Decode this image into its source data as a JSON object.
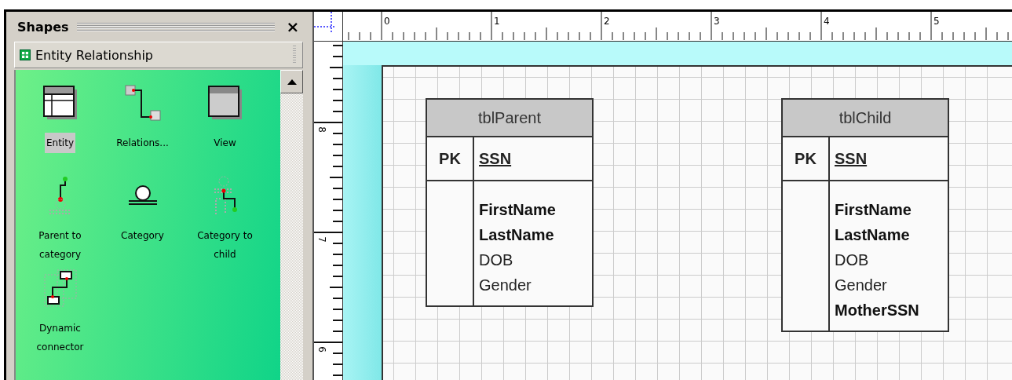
{
  "shapes_panel": {
    "title": "Shapes",
    "close": "×",
    "stencil": {
      "title": "Entity Relationship"
    },
    "items": [
      {
        "label": "Entity",
        "selected": true
      },
      {
        "label": "Relations...",
        "selected": false
      },
      {
        "label": "View",
        "selected": false
      },
      {
        "label": "Parent to category",
        "selected": false
      },
      {
        "label": "Category",
        "selected": false
      },
      {
        "label": "Category to child",
        "selected": false
      },
      {
        "label": "Dynamic connector",
        "selected": false
      }
    ]
  },
  "rulers": {
    "top_labels": [
      "0",
      "1",
      "2",
      "3",
      "4",
      "5"
    ],
    "left_labels": [
      "8",
      "7",
      "6"
    ]
  },
  "tables": [
    {
      "name": "tblParent",
      "key_label": "PK",
      "key_field": "SSN",
      "fields": [
        {
          "name": "FirstName",
          "bold": true
        },
        {
          "name": "LastName",
          "bold": true
        },
        {
          "name": "DOB",
          "bold": false
        },
        {
          "name": "Gender",
          "bold": false
        }
      ]
    },
    {
      "name": "tblChild",
      "key_label": "PK",
      "key_field": "SSN",
      "fields": [
        {
          "name": "FirstName",
          "bold": true
        },
        {
          "name": "LastName",
          "bold": true
        },
        {
          "name": "DOB",
          "bold": false
        },
        {
          "name": "Gender",
          "bold": false
        },
        {
          "name": "MotherSSN",
          "bold": true
        }
      ]
    }
  ]
}
